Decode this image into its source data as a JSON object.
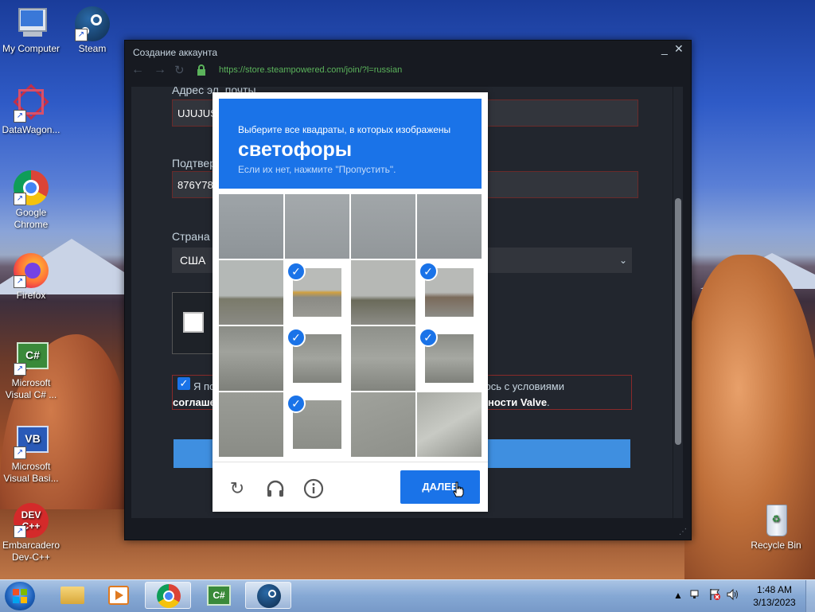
{
  "desktop_icons": [
    {
      "label": "My Computer"
    },
    {
      "label": "Steam"
    },
    {
      "label": "DataWagon..."
    },
    {
      "label": "Google Chrome"
    },
    {
      "label": "Firefox"
    },
    {
      "label": "Microsoft Visual C# ..."
    },
    {
      "label": "Microsoft Visual Basi..."
    },
    {
      "label": "Embarcadero Dev-C++"
    },
    {
      "label": "Recycle Bin"
    }
  ],
  "window": {
    "title": "Создание аккаунта",
    "url": "https://store.steampowered.com/join/?l=russian"
  },
  "form": {
    "email_label": "Адрес эл. почты",
    "email_value": "UJUJUS",
    "confirm_label": "Подтвер",
    "confirm_value": "876Y78",
    "country_label": "Страна",
    "country_value": "США",
    "agree_text_start": "Я по",
    "agree_text_end": "юсь с условиями",
    "agree_line2_start": "соглаше",
    "agree_line2_end": "ности Valve",
    "agree_line2_punct": "."
  },
  "captcha": {
    "instruction": "Выберите все квадраты, в которых изображены",
    "target": "светофоры",
    "hint": "Если их нет, нажмите \"Пропустить\".",
    "next_label": "ДАЛЕЕ",
    "selected_tiles": [
      5,
      7,
      9,
      11,
      13
    ]
  },
  "taskbar": {
    "time": "1:48 AM",
    "date": "3/13/2023"
  }
}
